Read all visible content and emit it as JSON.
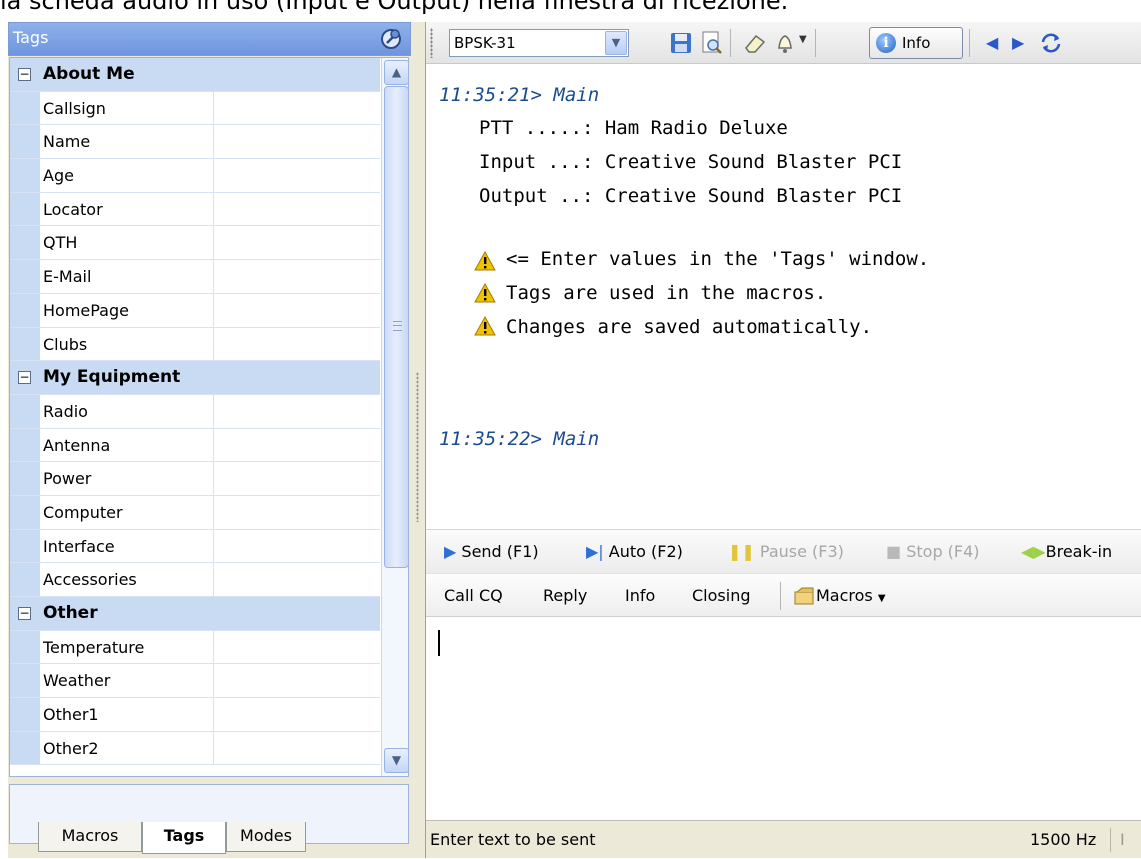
{
  "caption": "la scheda audio in uso (Input e Output) nella finestra di ricezione.",
  "tags_panel": {
    "title": "Tags",
    "categories": [
      {
        "name": "About Me",
        "items": [
          "Callsign",
          "Name",
          "Age",
          "Locator",
          "QTH",
          "E-Mail",
          "HomePage",
          "Clubs"
        ]
      },
      {
        "name": "My Equipment",
        "items": [
          "Radio",
          "Antenna",
          "Power",
          "Computer",
          "Interface",
          "Accessories"
        ]
      },
      {
        "name": "Other",
        "items": [
          "Temperature",
          "Weather",
          "Other1",
          "Other2"
        ]
      }
    ],
    "tabs": [
      "Macros",
      "Tags",
      "Modes"
    ],
    "active_tab": "Tags"
  },
  "toolbar": {
    "mode": "BPSK-31",
    "info_label": "Info",
    "icons": [
      "save-icon",
      "print-preview-icon",
      "eraser-icon",
      "bell-icon",
      "info-icon",
      "prev-arrow-icon",
      "next-arrow-icon",
      "refresh-icon"
    ]
  },
  "receive": {
    "ts1": "11:35:21> Main",
    "lines": [
      "PTT .....: Ham Radio Deluxe",
      "Input ...: Creative Sound Blaster PCI",
      "Output ..: Creative Sound Blaster PCI"
    ],
    "warnings": [
      "<= Enter values in the 'Tags' window.",
      "Tags are used in the macros.",
      "Changes are saved automatically."
    ],
    "ts2": "11:35:22> Main"
  },
  "actions": {
    "send": "Send (F1)",
    "auto": "Auto (F2)",
    "pause": "Pause (F3)",
    "stop": "Stop (F4)",
    "breakin": "Break-in"
  },
  "macros_bar": {
    "items": [
      "Call CQ",
      "Reply",
      "Info",
      "Closing"
    ],
    "macros_label": "Macros"
  },
  "status": {
    "text": "Enter text to be sent",
    "freq": "1500 Hz",
    "next": "I"
  },
  "colors": {
    "tags_header": "#7fa2e4",
    "category_bg": "#c9daf3",
    "timestamp": "#1b4b8f",
    "warning": "#f2c200"
  }
}
